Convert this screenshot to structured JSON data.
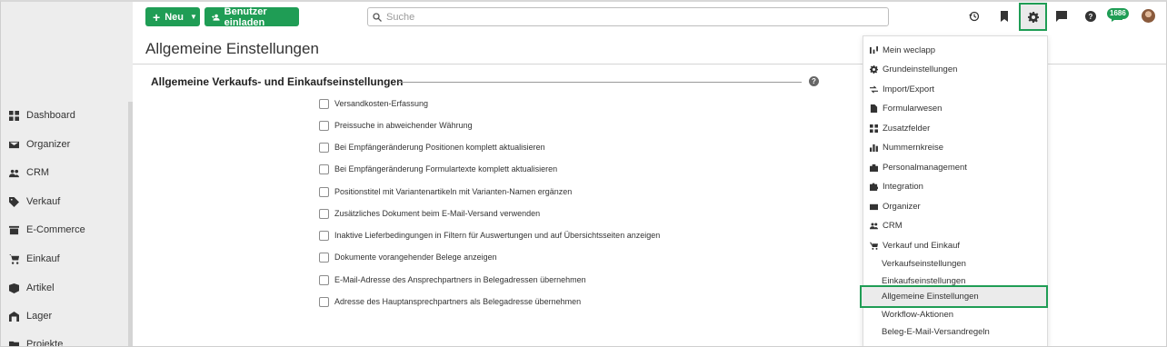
{
  "topbar": {
    "new_label": "Neu",
    "invite_label": "Benutzer einladen",
    "search_placeholder": "Suche",
    "notification_count": "1686",
    "icons": [
      "history-icon",
      "bookmark-icon",
      "gear-icon",
      "chat-icon",
      "help-icon",
      "notification-icon"
    ]
  },
  "sidebar": {
    "items": [
      {
        "label": "Dashboard",
        "icon": "dashboard-icon"
      },
      {
        "label": "Organizer",
        "icon": "mail-icon"
      },
      {
        "label": "CRM",
        "icon": "people-icon"
      },
      {
        "label": "Verkauf",
        "icon": "tag-icon"
      },
      {
        "label": "E-Commerce",
        "icon": "store-icon"
      },
      {
        "label": "Einkauf",
        "icon": "cart-icon"
      },
      {
        "label": "Artikel",
        "icon": "box-icon"
      },
      {
        "label": "Lager",
        "icon": "warehouse-icon"
      },
      {
        "label": "Projekte",
        "icon": "folder-icon"
      }
    ]
  },
  "page": {
    "title": "Allgemeine Einstellungen",
    "section_title": "Allgemeine Verkaufs- und Einkaufseinstellungen",
    "help": "?",
    "options": [
      {
        "label": "Versandkosten-Erfassung",
        "checked": false
      },
      {
        "label": "Preissuche in abweichender Währung",
        "checked": false
      },
      {
        "label": "Bei Empfängeränderung Positionen komplett aktualisieren",
        "checked": false
      },
      {
        "label": "Bei Empfängeränderung Formulartexte komplett aktualisieren",
        "checked": false
      },
      {
        "label": "Positionstitel mit Variantenartikeln mit Varianten-Namen ergänzen",
        "checked": false
      },
      {
        "label": "Zusätzliches Dokument beim E-Mail-Versand verwenden",
        "checked": false
      },
      {
        "label": "Inaktive Lieferbedingungen in Filtern für Auswertungen und auf Übersichtsseiten anzeigen",
        "checked": false
      },
      {
        "label": "Dokumente vorangehender Belege anzeigen",
        "checked": false
      },
      {
        "label": "E-Mail-Adresse des Ansprechpartners in Belegadressen übernehmen",
        "checked": false
      },
      {
        "label": "Adresse des Hauptansprechpartners als Belegadresse übernehmen",
        "checked": false
      }
    ]
  },
  "settings_menu": {
    "items": [
      {
        "label": "Mein weclapp",
        "icon": "weclapp-icon"
      },
      {
        "label": "Grundeinstellungen",
        "icon": "gear-icon"
      },
      {
        "label": "Import/Export",
        "icon": "import-export-icon"
      },
      {
        "label": "Formularwesen",
        "icon": "document-icon"
      },
      {
        "label": "Zusatzfelder",
        "icon": "fields-icon"
      },
      {
        "label": "Nummernkreise",
        "icon": "bar-chart-icon"
      },
      {
        "label": "Personalmanagement",
        "icon": "briefcase-icon"
      },
      {
        "label": "Integration",
        "icon": "puzzle-icon"
      },
      {
        "label": "Organizer",
        "icon": "mail-icon"
      },
      {
        "label": "CRM",
        "icon": "people-icon"
      },
      {
        "label": "Verkauf und Einkauf",
        "icon": "cart-plus-icon"
      }
    ],
    "subitems": [
      {
        "label": "Verkaufseinstellungen"
      },
      {
        "label": "Einkaufseinstellungen"
      },
      {
        "label": "Allgemeine Einstellungen",
        "selected": true
      },
      {
        "label": "Workflow-Aktionen"
      },
      {
        "label": "Beleg-E-Mail-Versandregeln"
      }
    ]
  },
  "colors": {
    "accent": "#1f9d55",
    "sidebar_bg": "#ededed",
    "selected_bg": "#ebebeb"
  }
}
